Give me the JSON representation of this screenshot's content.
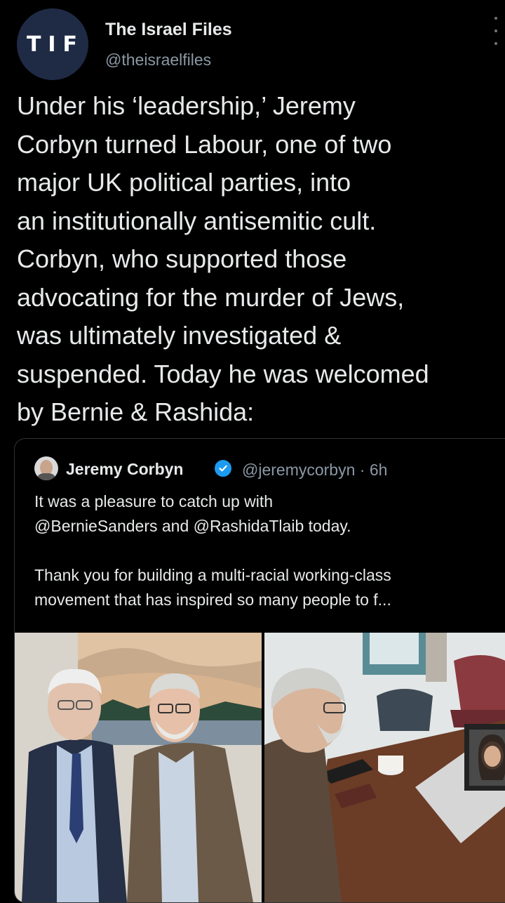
{
  "author": {
    "logo": "T I F",
    "name": "The Israel Files",
    "handle": "@theisraelfiles"
  },
  "tweet": {
    "text": "Under his ‘leadership,’ Jeremy\nCorbyn turned Labour, one of two\nmajor UK political parties, into\nan institutionally antisemitic cult.\nCorbyn, who supported those\nadvocating for the murder of Jews,\nwas ultimately investigated &\nsuspended. Today he was welcomed\nby Bernie & Rashida:"
  },
  "quote": {
    "name": "Jeremy Corbyn",
    "handle_time": "@jeremycorbyn · 6h",
    "text": "It was a pleasure to catch up with\n@BernieSanders and @RashidaTlaib today.\n\nThank you for building a multi-racial working-class\nmovement that has inspired so many people to f..."
  },
  "colors": {
    "background": "#000000",
    "text": "#e7e9ea",
    "secondary": "#8b98a5",
    "verified": "#1d9bf0",
    "border": "#2f3336"
  },
  "icons": [
    "more-icon",
    "verified-icon"
  ]
}
